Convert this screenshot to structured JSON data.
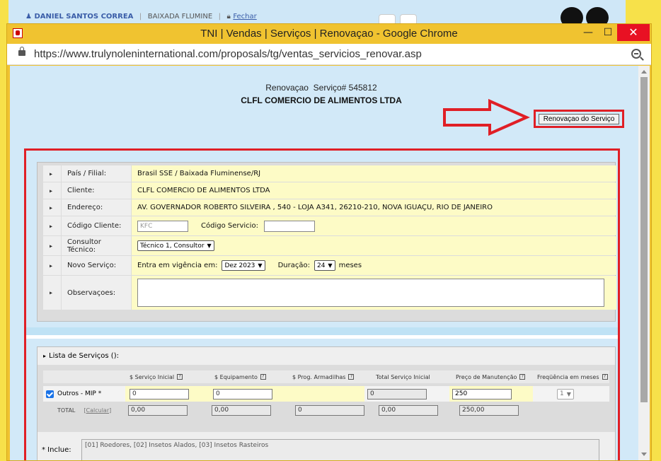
{
  "background_app": {
    "user_name": "DANIEL SANTOS CORREA",
    "branch": "BAIXADA FLUMINE",
    "logout": "Fechar"
  },
  "window": {
    "title": "TNI | Vendas | Serviços | Renovaçao - Google Chrome",
    "url": "https://www.trulynoleninternational.com/proposals/tg/ventas_servicios_renovar.asp",
    "close": "✕",
    "maximize": "☐",
    "minimize": "—"
  },
  "header": {
    "line1": "Renovaçao  Serviço# 545812",
    "line2": "CLFL COMERCIO DE ALIMENTOS LTDA",
    "action_button": "Renovaçao do Serviço"
  },
  "form": {
    "pais_label": "País / Filial:",
    "pais_value": "Brasil SSE / Baixada Fluminense/RJ",
    "cliente_label": "Cliente:",
    "cliente_value": "CLFL COMERCIO DE ALIMENTOS LTDA",
    "endereco_label": "Endereço:",
    "endereco_value": "AV. GOVERNADOR ROBERTO SILVEIRA , 540 - LOJA A341, 26210-210, NOVA IGUAÇU, RIO DE JANEIRO",
    "codigo_cliente_label": "Código Cliente:",
    "codigo_cliente_placeholder": "KFC",
    "codigo_servicio_label": "Código Servicio:",
    "codigo_servicio_value": "",
    "consultor_label": "Consultor Técnico:",
    "consultor_value": "Técnico 1, Consultor",
    "novo_servico_label": "Novo Serviço:",
    "vigencia_label": "Entra em vigência em:",
    "vigencia_value": "Dez 2023",
    "duracao_label": "Duração:",
    "duracao_value": "24",
    "meses_label": "meses",
    "observacoes_label": "Observaçoes:",
    "observacoes_value": ""
  },
  "services": {
    "title": "Lista de Serviços ():",
    "columns": [
      "$ Serviço Inicial",
      "$ Equipamento",
      "$ Prog. Armadilhas",
      "Total Serviço Inicial",
      "Preço de Manutenção",
      "Freqüência em meses"
    ],
    "help_glyph": "?",
    "row": {
      "name": "Outros - MIP *",
      "servico_inicial": "0",
      "equipamento": "0",
      "total_servico_inicial": "0",
      "preco_manutencao": "250",
      "frequencia": "1"
    },
    "total": {
      "label": "TOTAL",
      "calcular": "[Calcular]",
      "servico_inicial": "0,00",
      "equipamento": "0,00",
      "prog_armadilhas": "0",
      "total_servico_inicial": "0,00",
      "preco_manutencao": "250,00"
    },
    "inclui_label": "* Inclue:",
    "inclui_value": "[01] Roedores, [02] Insetos Alados, [03] Insetos Rasteiros"
  },
  "colors": {
    "highlight_red": "#e01f26",
    "field_yellow": "#fdfbc6",
    "page_blue": "#d2e9f8"
  }
}
